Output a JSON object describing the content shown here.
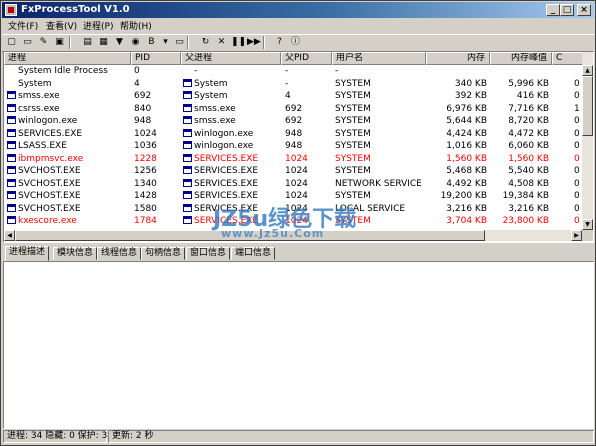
{
  "window": {
    "title": "FxProcessTool V1.0"
  },
  "menu": [
    "文件(F)",
    "查看(V)",
    "进程(P)",
    "帮助(H)"
  ],
  "toolbar": {
    "buttons": [
      {
        "name": "new-icon",
        "glyph": "▢"
      },
      {
        "name": "open-folder-icon",
        "glyph": "▭"
      },
      {
        "name": "edit-icon",
        "glyph": "✎"
      },
      {
        "name": "save-icon",
        "glyph": "▣"
      },
      {
        "name": "properties-icon",
        "glyph": "▤"
      },
      {
        "name": "window-icon",
        "glyph": "▦"
      },
      {
        "name": "view-down-icon",
        "glyph": "▼"
      },
      {
        "name": "target-icon",
        "glyph": "◉"
      },
      {
        "name": "bold-icon",
        "glyph": "B"
      },
      {
        "name": "dropdown-icon",
        "glyph": "▾"
      },
      {
        "name": "folder-icon",
        "glyph": "▭"
      },
      {
        "name": "refresh-icon",
        "glyph": "↻"
      },
      {
        "name": "kill-icon",
        "glyph": "✕"
      },
      {
        "name": "pause-icon",
        "glyph": "❚❚"
      },
      {
        "name": "resume-icon",
        "glyph": "▶▶"
      },
      {
        "name": "help-icon",
        "glyph": "?"
      },
      {
        "name": "about-icon",
        "glyph": "ⓘ"
      }
    ]
  },
  "table": {
    "columns": [
      "进程",
      "PID",
      "父进程",
      "父PID",
      "用户名",
      "内存",
      "内存峰值",
      "C"
    ],
    "rows": [
      {
        "icon": "blank",
        "name": "System Idle Process",
        "pid": "0",
        "picon": "blank",
        "parent": "-",
        "ppid": "-",
        "user": "-",
        "mem": "",
        "peak": "",
        "c": "",
        "red": false
      },
      {
        "icon": "blank",
        "name": "System",
        "pid": "4",
        "picon": "window",
        "parent": "System",
        "ppid": "-",
        "user": "SYSTEM",
        "mem": "340 KB",
        "peak": "5,996 KB",
        "c": "0",
        "red": false
      },
      {
        "icon": "window",
        "name": "smss.exe",
        "pid": "692",
        "picon": "window",
        "parent": "System",
        "ppid": "4",
        "user": "SYSTEM",
        "mem": "392 KB",
        "peak": "416 KB",
        "c": "0",
        "red": false
      },
      {
        "icon": "window",
        "name": "csrss.exe",
        "pid": "840",
        "picon": "window",
        "parent": "smss.exe",
        "ppid": "692",
        "user": "SYSTEM",
        "mem": "6,976 KB",
        "peak": "7,716 KB",
        "c": "1",
        "red": false
      },
      {
        "icon": "window",
        "name": "winlogon.exe",
        "pid": "948",
        "picon": "window",
        "parent": "smss.exe",
        "ppid": "692",
        "user": "SYSTEM",
        "mem": "5,644 KB",
        "peak": "8,720 KB",
        "c": "0",
        "red": false
      },
      {
        "icon": "window",
        "name": "SERVICES.EXE",
        "pid": "1024",
        "picon": "window",
        "parent": "winlogon.exe",
        "ppid": "948",
        "user": "SYSTEM",
        "mem": "4,424 KB",
        "peak": "4,472 KB",
        "c": "0",
        "red": false
      },
      {
        "icon": "window",
        "name": "LSASS.EXE",
        "pid": "1036",
        "picon": "window",
        "parent": "winlogon.exe",
        "ppid": "948",
        "user": "SYSTEM",
        "mem": "1,016 KB",
        "peak": "6,060 KB",
        "c": "0",
        "red": false
      },
      {
        "icon": "window",
        "name": "ibmpmsvc.exe",
        "pid": "1228",
        "picon": "window",
        "parent": "SERVICES.EXE",
        "ppid": "1024",
        "user": "SYSTEM",
        "mem": "1,560 KB",
        "peak": "1,560 KB",
        "c": "0",
        "red": true
      },
      {
        "icon": "window",
        "name": "SVCHOST.EXE",
        "pid": "1256",
        "picon": "window",
        "parent": "SERVICES.EXE",
        "ppid": "1024",
        "user": "SYSTEM",
        "mem": "5,468 KB",
        "peak": "5,540 KB",
        "c": "0",
        "red": false
      },
      {
        "icon": "window",
        "name": "SVCHOST.EXE",
        "pid": "1340",
        "picon": "window",
        "parent": "SERVICES.EXE",
        "ppid": "1024",
        "user": "NETWORK SERVICE",
        "mem": "4,492 KB",
        "peak": "4,508 KB",
        "c": "0",
        "red": false
      },
      {
        "icon": "window",
        "name": "SVCHOST.EXE",
        "pid": "1428",
        "picon": "window",
        "parent": "SERVICES.EXE",
        "ppid": "1024",
        "user": "SYSTEM",
        "mem": "19,200 KB",
        "peak": "19,384 KB",
        "c": "0",
        "red": false
      },
      {
        "icon": "window",
        "name": "SVCHOST.EXE",
        "pid": "1580",
        "picon": "window",
        "parent": "SERVICES.EXE",
        "ppid": "1024",
        "user": "LOCAL SERVICE",
        "mem": "3,216 KB",
        "peak": "3,216 KB",
        "c": "0",
        "red": false
      },
      {
        "icon": "window",
        "name": "kxescore.exe",
        "pid": "1784",
        "picon": "window",
        "parent": "SERVICES.EXE",
        "ppid": "1024",
        "user": "SYSTEM",
        "mem": "3,704 KB",
        "peak": "23,800 KB",
        "c": "0",
        "red": true
      }
    ]
  },
  "tabs": [
    "进程描述",
    "模块信息",
    "线程信息",
    "句柄信息",
    "窗口信息",
    "端口信息"
  ],
  "status": {
    "left": "进程: 34  隐藏: 0  保护: 3",
    "right": "更新: 2 秒"
  },
  "watermark": {
    "main": "JZ5u绿色下载",
    "url": "www.Jz5u.Com"
  }
}
